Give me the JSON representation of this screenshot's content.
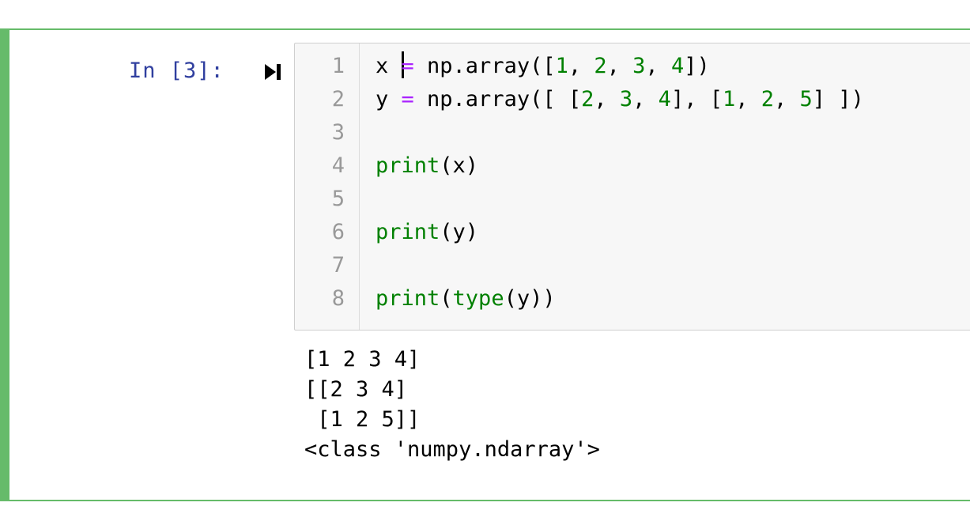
{
  "cell": {
    "prompt": "In [3]:",
    "accent_color": "#66bb6a",
    "run_icon": "run-cell-icon"
  },
  "editor": {
    "line_numbers": [
      "1",
      "2",
      "3",
      "4",
      "5",
      "6",
      "7",
      "8"
    ],
    "lines": [
      [
        {
          "t": "x ",
          "c": ""
        },
        {
          "t": "CURSOR",
          "c": "cursor"
        },
        {
          "t": "=",
          "c": "op"
        },
        {
          "t": " np.array([",
          "c": ""
        },
        {
          "t": "1",
          "c": "num"
        },
        {
          "t": ", ",
          "c": ""
        },
        {
          "t": "2",
          "c": "num"
        },
        {
          "t": ", ",
          "c": ""
        },
        {
          "t": "3",
          "c": "num"
        },
        {
          "t": ", ",
          "c": ""
        },
        {
          "t": "4",
          "c": "num"
        },
        {
          "t": "])",
          "c": ""
        }
      ],
      [
        {
          "t": "y ",
          "c": ""
        },
        {
          "t": "=",
          "c": "op"
        },
        {
          "t": " np.array([ [",
          "c": ""
        },
        {
          "t": "2",
          "c": "num"
        },
        {
          "t": ", ",
          "c": ""
        },
        {
          "t": "3",
          "c": "num"
        },
        {
          "t": ", ",
          "c": ""
        },
        {
          "t": "4",
          "c": "num"
        },
        {
          "t": "], [",
          "c": ""
        },
        {
          "t": "1",
          "c": "num"
        },
        {
          "t": ", ",
          "c": ""
        },
        {
          "t": "2",
          "c": "num"
        },
        {
          "t": ", ",
          "c": ""
        },
        {
          "t": "5",
          "c": "num"
        },
        {
          "t": "] ])",
          "c": ""
        }
      ],
      [],
      [
        {
          "t": "print",
          "c": "kw"
        },
        {
          "t": "(x)",
          "c": ""
        }
      ],
      [],
      [
        {
          "t": "print",
          "c": "kw"
        },
        {
          "t": "(y)",
          "c": ""
        }
      ],
      [],
      [
        {
          "t": "print",
          "c": "kw"
        },
        {
          "t": "(",
          "c": ""
        },
        {
          "t": "type",
          "c": "kw"
        },
        {
          "t": "(y))",
          "c": ""
        }
      ]
    ]
  },
  "output": {
    "lines": [
      "[1 2 3 4]",
      "[[2 3 4]",
      " [1 2 5]]",
      "<class 'numpy.ndarray'>"
    ]
  }
}
